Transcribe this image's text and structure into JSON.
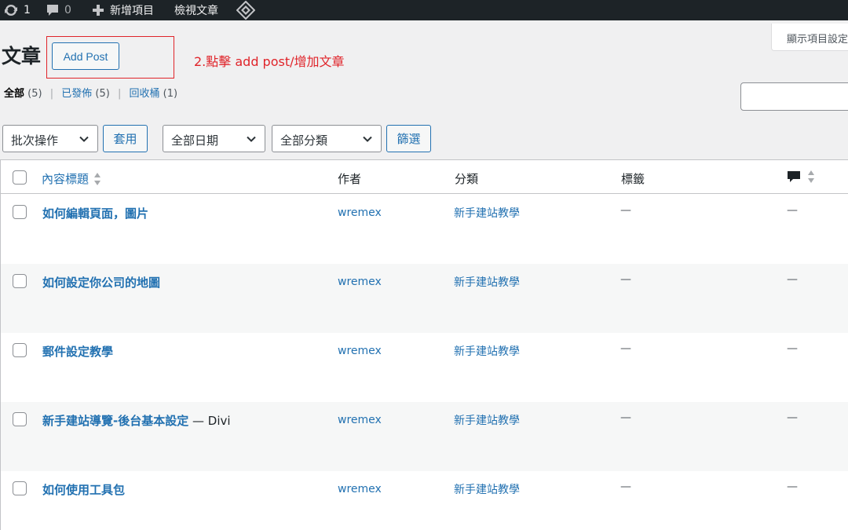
{
  "admin_bar": {
    "updates_count": "1",
    "comments_count": "0",
    "new_item": "新增項目",
    "view_posts": "檢視文章"
  },
  "header": {
    "title": "文章",
    "add_post": "Add Post",
    "annotation": "2.點擊 add post/增加文章",
    "screen_options": "顯示項目設定"
  },
  "filters": {
    "all": "全部",
    "all_count": "(5)",
    "published": "已發佈",
    "published_count": "(5)",
    "trash": "回收桶",
    "trash_count": "(1)",
    "sep": "|"
  },
  "tablenav": {
    "bulk_action": "批次操作",
    "apply": "套用",
    "all_dates": "全部日期",
    "all_categories": "全部分類",
    "filter": "篩選"
  },
  "table": {
    "headers": {
      "title": "內容標題",
      "author": "作者",
      "categories": "分類",
      "tags": "標籤"
    },
    "rows": [
      {
        "title": "如何編輯頁面，圖片",
        "suffix": "",
        "author": "wremex",
        "category": "新手建站教學",
        "tags": "—",
        "comments": "—"
      },
      {
        "title": "如何設定你公司的地圖",
        "suffix": "",
        "author": "wremex",
        "category": "新手建站教學",
        "tags": "—",
        "comments": "—"
      },
      {
        "title": "郵件設定教學",
        "suffix": "",
        "author": "wremex",
        "category": "新手建站教學",
        "tags": "—",
        "comments": "—"
      },
      {
        "title": "新手建站導覽-後台基本設定",
        "suffix": " — Divi",
        "author": "wremex",
        "category": "新手建站教學",
        "tags": "—",
        "comments": "—"
      },
      {
        "title": "如何使用工具包",
        "suffix": "",
        "author": "wremex",
        "category": "新手建站教學",
        "tags": "—",
        "comments": "—"
      }
    ]
  }
}
